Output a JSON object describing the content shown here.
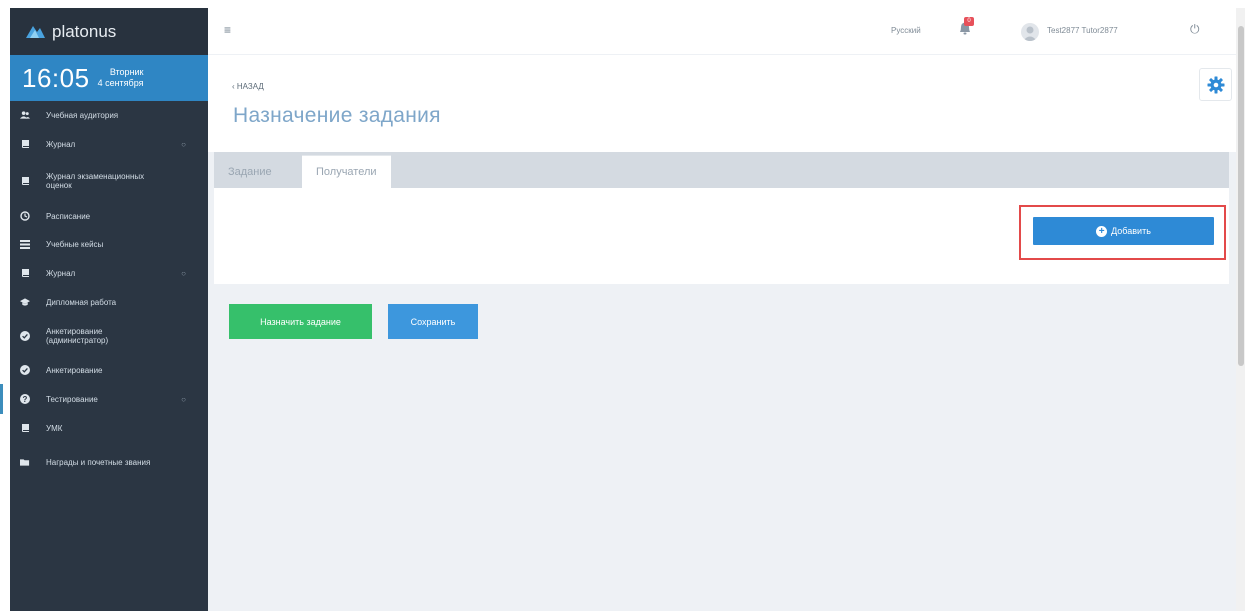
{
  "brand": {
    "name": "platonus",
    "logo_icon": "platonus-logo-icon"
  },
  "clock": {
    "time": "16:05",
    "weekday": "Вторник",
    "date": "4 сентября"
  },
  "sidebar": {
    "items": [
      {
        "label": "Учебная аудитория",
        "icon": "users-icon",
        "has_arrow": false
      },
      {
        "label": "Журнал",
        "icon": "book-icon",
        "has_arrow": true
      },
      {
        "label": "Журнал экзаменационных оценок",
        "icon": "book-icon",
        "has_arrow": false
      },
      {
        "label": "Расписание",
        "icon": "clock-icon",
        "has_arrow": false
      },
      {
        "label": "Учебные кейсы",
        "icon": "list-icon",
        "has_arrow": false
      },
      {
        "label": "Журнал",
        "icon": "book-icon",
        "has_arrow": true
      },
      {
        "label": "Дипломная работа",
        "icon": "graduation-cap-icon",
        "has_arrow": false
      },
      {
        "label": "Анкетирование (администратор)",
        "icon": "check-circle-icon",
        "has_arrow": false
      },
      {
        "label": "Анкетирование",
        "icon": "check-circle-icon",
        "has_arrow": false
      },
      {
        "label": "Тестирование",
        "icon": "question-circle-icon",
        "has_arrow": true
      },
      {
        "label": "УМК",
        "icon": "book-icon",
        "has_arrow": false
      },
      {
        "label": "Награды и почетные звания",
        "icon": "folder-icon",
        "has_arrow": false
      }
    ],
    "arrow_glyph": "○"
  },
  "header": {
    "menu_glyph": "≡",
    "language": "Русский",
    "notification_count": "0",
    "user_name": "Test2877 Tutor2877",
    "power_glyph": "⏻"
  },
  "page": {
    "back_label": "‹ НАЗАД",
    "title": "Назначение задания",
    "tabs": [
      {
        "label": "Задание",
        "active": false
      },
      {
        "label": "Получатели",
        "active": true
      }
    ],
    "add_button": "Добавить",
    "assign_button": "Назначить задание",
    "save_button": "Сохранить"
  },
  "colors": {
    "sidebar_bg": "#2b3643",
    "clock_bg": "#2f86c4",
    "title": "#7ea6c9",
    "primary": "#2e8ad6",
    "success": "#36c06b",
    "highlight": "#e34a4a"
  }
}
